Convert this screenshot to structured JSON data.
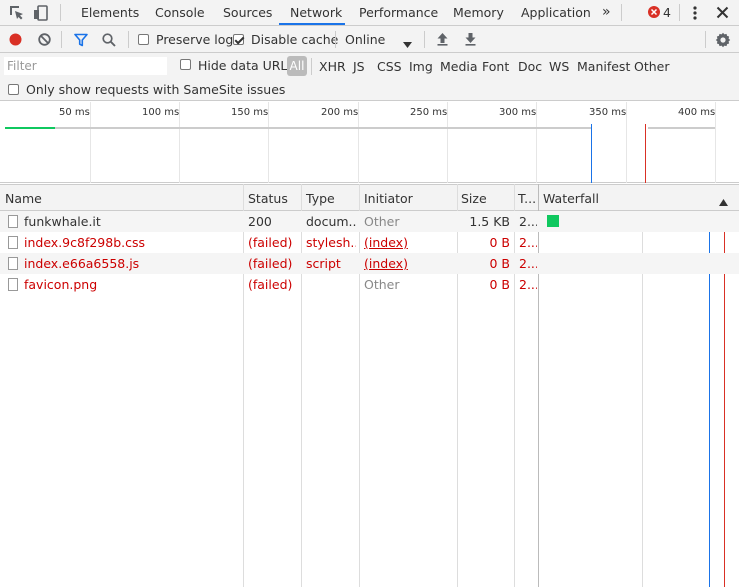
{
  "tabs": {
    "items": [
      {
        "label": "Elements"
      },
      {
        "label": "Console"
      },
      {
        "label": "Sources"
      },
      {
        "label": "Network"
      },
      {
        "label": "Performance"
      },
      {
        "label": "Memory"
      },
      {
        "label": "Application"
      }
    ],
    "active": "Network",
    "overflow_icon": "double-chevron-right-icon",
    "error_count": "4"
  },
  "toolbar": {
    "preserve_log_label": "Preserve log",
    "preserve_log_checked": false,
    "disable_cache_label": "Disable cache",
    "disable_cache_checked": true,
    "throttling_value": "Online"
  },
  "filter": {
    "placeholder": "Filter",
    "hide_data_urls_label": "Hide data URLs",
    "types": [
      "All",
      "XHR",
      "JS",
      "CSS",
      "Img",
      "Media",
      "Font",
      "Doc",
      "WS",
      "Manifest",
      "Other"
    ],
    "samesite_label": "Only show requests with SameSite issues"
  },
  "overview": {
    "ticks": [
      "50 ms",
      "100 ms",
      "150 ms",
      "200 ms",
      "250 ms",
      "300 ms",
      "350 ms",
      "400 ms"
    ]
  },
  "table": {
    "headers": {
      "name": "Name",
      "status": "Status",
      "type": "Type",
      "initiator": "Initiator",
      "size": "Size",
      "time": "T...",
      "waterfall": "Waterfall"
    },
    "rows": [
      {
        "name": "funkwhale.it",
        "status": "200",
        "type": "docum...",
        "initiator": "Other",
        "size": "1.5 KB",
        "time": "2...",
        "failed": false
      },
      {
        "name": "index.9c8f298b.css",
        "status": "(failed)",
        "type": "stylesh...",
        "initiator": "(index)",
        "size": "0 B",
        "time": "2...",
        "failed": true
      },
      {
        "name": "index.e66a6558.js",
        "status": "(failed)",
        "type": "script",
        "initiator": "(index)",
        "size": "0 B",
        "time": "2...",
        "failed": true
      },
      {
        "name": "favicon.png",
        "status": "(failed)",
        "type": "",
        "initiator": "Other",
        "size": "0 B",
        "time": "2...",
        "failed": true
      }
    ]
  },
  "colors": {
    "record": "#d93025",
    "accent": "#1a73e8",
    "failed": "#cc0000",
    "waterfall_bar": "#0fc85f",
    "load_line": "#d93025",
    "dcl_line": "#1a73e8"
  }
}
